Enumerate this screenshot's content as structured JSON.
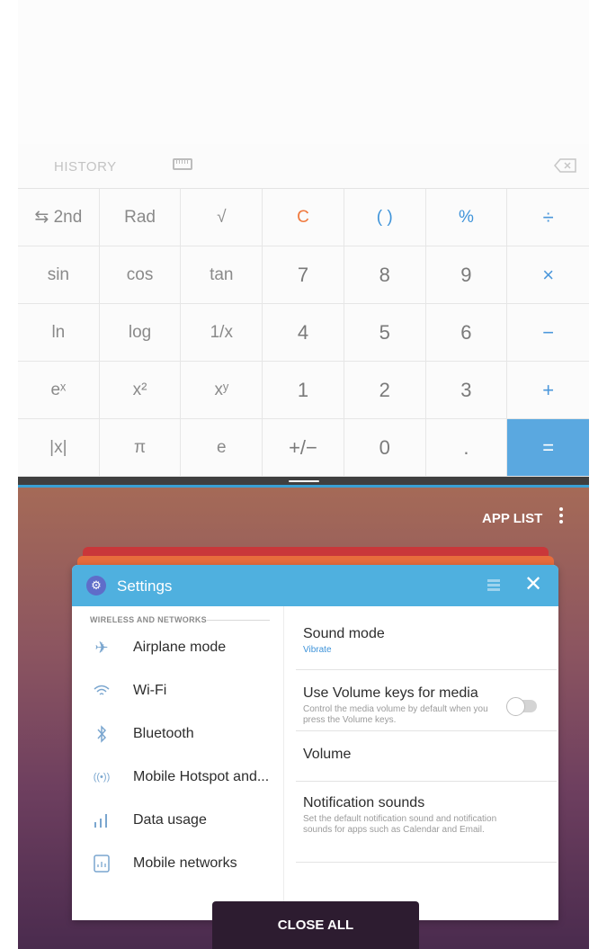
{
  "calculator": {
    "history_label": "HISTORY",
    "keys": [
      [
        "⇆ 2nd",
        "Rad",
        "√",
        "C",
        "( )",
        "%",
        "÷"
      ],
      [
        "sin",
        "cos",
        "tan",
        "7",
        "8",
        "9",
        "×"
      ],
      [
        "ln",
        "log",
        "1/x",
        "4",
        "5",
        "6",
        "−"
      ],
      [
        "eˣ",
        "x²",
        "xʸ",
        "1",
        "2",
        "3",
        "+"
      ],
      [
        "|x|",
        "π",
        "e",
        "+/−",
        "0",
        ".",
        "="
      ]
    ]
  },
  "recents": {
    "app_list_label": "APP LIST",
    "close_all_label": "CLOSE ALL",
    "settings_card": {
      "title": "Settings",
      "section_label": "WIRELESS AND NETWORKS",
      "left_items": [
        {
          "label": "Airplane mode",
          "icon": "airplane-icon"
        },
        {
          "label": "Wi-Fi",
          "icon": "wifi-icon"
        },
        {
          "label": "Bluetooth",
          "icon": "bluetooth-icon"
        },
        {
          "label": "Mobile Hotspot and...",
          "icon": "hotspot-icon"
        },
        {
          "label": "Data usage",
          "icon": "data-usage-icon"
        },
        {
          "label": "Mobile networks",
          "icon": "mobile-networks-icon"
        }
      ],
      "right_items": {
        "sound_mode": {
          "title": "Sound mode",
          "subtitle": "Vibrate"
        },
        "volume_keys": {
          "title": "Use Volume keys for media",
          "subtitle": "Control the media volume by default when you press the Volume keys.",
          "toggle_on": false
        },
        "volume": {
          "title": "Volume"
        },
        "notification_sounds": {
          "title": "Notification sounds",
          "subtitle": "Set the default notification sound and notification sounds for apps such as Calendar and Email."
        }
      }
    }
  },
  "colors": {
    "accent_blue": "#5aa8e0",
    "clear_orange": "#f07a3f",
    "settings_header": "#4fb0df"
  }
}
